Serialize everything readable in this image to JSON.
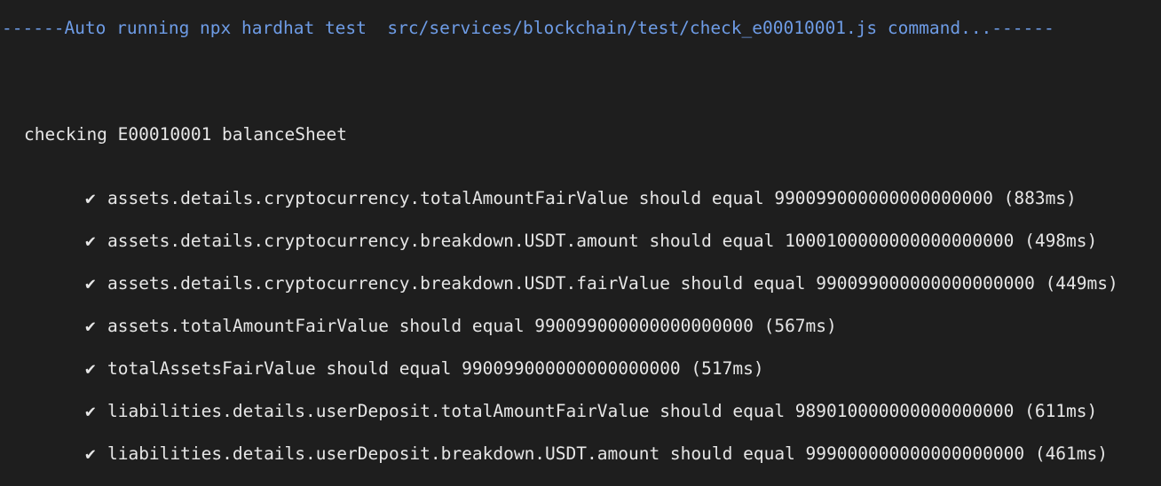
{
  "terminal": {
    "header": "------Auto running npx hardhat test  src/services/blockchain/test/check_e00010001.js command...------",
    "suite": "checking E00010001 balanceSheet",
    "check_glyph": "✔",
    "tests": [
      {
        "text": "assets.details.cryptocurrency.totalAmountFairValue should equal 990099000000000000000 (883ms)"
      },
      {
        "text": "assets.details.cryptocurrency.breakdown.USDT.amount should equal 1000100000000000000000 (498ms)"
      },
      {
        "text": "assets.details.cryptocurrency.breakdown.USDT.fairValue should equal 990099000000000000000 (449ms)"
      },
      {
        "text": "assets.totalAmountFairValue should equal 990099000000000000000 (567ms)"
      },
      {
        "text": "totalAssetsFairValue should equal 990099000000000000000 (517ms)"
      },
      {
        "text": "liabilities.details.userDeposit.totalAmountFairValue should equal 989010000000000000000 (611ms)"
      },
      {
        "text": "liabilities.details.userDeposit.breakdown.USDT.amount should equal 999000000000000000000 (461ms)"
      }
    ]
  }
}
